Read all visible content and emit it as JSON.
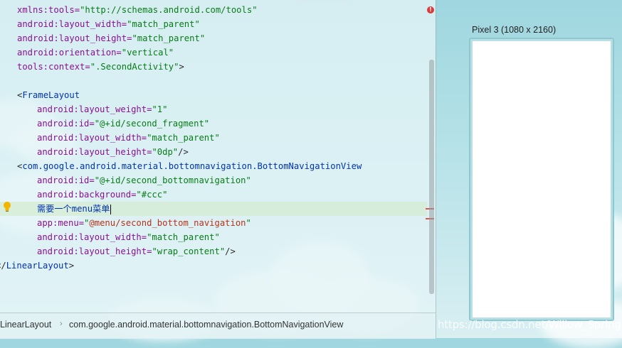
{
  "editor": {
    "lines": [
      {
        "id": "l1",
        "parts": [
          {
            "t": "xmlns:tools=",
            "c": "attr"
          },
          {
            "t": "\"http://schemas.android.com/tools\"",
            "c": "val"
          }
        ]
      },
      {
        "id": "l2",
        "parts": [
          {
            "t": "android:layout_width=",
            "c": "attr"
          },
          {
            "t": "\"match_parent\"",
            "c": "val"
          }
        ]
      },
      {
        "id": "l3",
        "parts": [
          {
            "t": "android:layout_height=",
            "c": "attr"
          },
          {
            "t": "\"match_parent\"",
            "c": "val"
          }
        ]
      },
      {
        "id": "l4",
        "parts": [
          {
            "t": "android:orientation=",
            "c": "attr"
          },
          {
            "t": "\"vertical\"",
            "c": "val"
          }
        ]
      },
      {
        "id": "l5",
        "parts": [
          {
            "t": "tools:context=",
            "c": "attr"
          },
          {
            "t": "\".SecondActivity\"",
            "c": "val"
          },
          {
            "t": ">",
            "c": "plain"
          }
        ]
      },
      {
        "id": "l6",
        "parts": []
      },
      {
        "id": "l7",
        "parts": [
          {
            "t": "<",
            "c": "plain"
          },
          {
            "t": "FrameLayout",
            "c": "tag"
          }
        ]
      },
      {
        "id": "l8",
        "parts": [
          {
            "t": "android:layout_weight=",
            "c": "attr"
          },
          {
            "t": "\"1\"",
            "c": "val"
          }
        ]
      },
      {
        "id": "l9",
        "parts": [
          {
            "t": "android:id=",
            "c": "attr"
          },
          {
            "t": "\"@+id/second_fragment\"",
            "c": "val"
          }
        ]
      },
      {
        "id": "l10",
        "parts": [
          {
            "t": "android:layout_width=",
            "c": "attr"
          },
          {
            "t": "\"match_parent\"",
            "c": "val"
          }
        ]
      },
      {
        "id": "l11",
        "parts": [
          {
            "t": "android:layout_height=",
            "c": "attr"
          },
          {
            "t": "\"0dp\"",
            "c": "val"
          },
          {
            "t": "/>",
            "c": "plain"
          }
        ]
      },
      {
        "id": "l12",
        "parts": [
          {
            "t": "<",
            "c": "plain"
          },
          {
            "t": "com.google.android.material.bottomnavigation.BottomNavigationView",
            "c": "tag"
          }
        ]
      },
      {
        "id": "l13",
        "parts": [
          {
            "t": "android:id=",
            "c": "attr"
          },
          {
            "t": "\"@+id/second_bottomnavigation\"",
            "c": "val"
          }
        ]
      },
      {
        "id": "l14",
        "parts": [
          {
            "t": "android:background=",
            "c": "attr"
          },
          {
            "t": "\"#ccc\"",
            "c": "val"
          }
        ]
      },
      {
        "id": "l15",
        "parts": [
          {
            "t": "需要一个menu菜单",
            "c": "tcolor"
          }
        ]
      },
      {
        "id": "l16",
        "parts": [
          {
            "t": "app:menu=",
            "c": "attr"
          },
          {
            "t": "\"",
            "c": "val"
          },
          {
            "t": "@menu/second_bottom_navigation",
            "c": "menuval"
          },
          {
            "t": "\"",
            "c": "val"
          }
        ]
      },
      {
        "id": "l17",
        "parts": [
          {
            "t": "android:layout_width=",
            "c": "attr"
          },
          {
            "t": "\"match_parent\"",
            "c": "val"
          }
        ]
      },
      {
        "id": "l18",
        "parts": [
          {
            "t": "android:layout_height=",
            "c": "attr"
          },
          {
            "t": "\"wrap_content\"",
            "c": "val"
          },
          {
            "t": "/>",
            "c": "plain"
          }
        ]
      },
      {
        "id": "l19",
        "parts": [
          {
            "t": "</",
            "c": "plain"
          },
          {
            "t": "LinearLayout",
            "c": "tag"
          },
          {
            "t": ">",
            "c": "plain"
          }
        ]
      }
    ]
  },
  "breadcrumb": {
    "items": [
      "LinearLayout",
      "com.google.android.material.bottomnavigation.BottomNavigationView"
    ],
    "separator": "›"
  },
  "preview": {
    "device_label": "Pixel 3 (1080 x 2160)"
  },
  "watermark": "https://blog.csdn.net/Willow_Spring",
  "error_icon": "!",
  "icons": {
    "error": "error-icon",
    "bulb": "lightbulb-icon"
  },
  "colors": {
    "attr": "#871094",
    "value": "#067d17",
    "tag": "#0033b3",
    "menu_ref": "#b8321a",
    "highlight": "#d6ecd6",
    "error": "#d93b3b"
  }
}
